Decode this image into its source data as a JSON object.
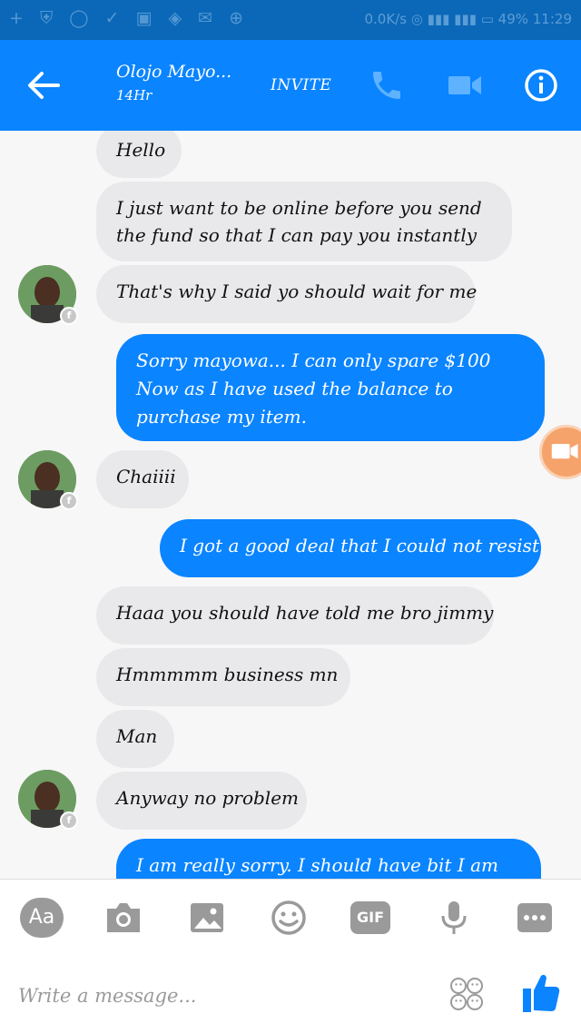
{
  "status_bar": {
    "left_icons": "+ ⛨ ◯ ✓ ▣ ◈ ✉ ⊕",
    "right_text": "0.0K/s  ◎  ▮▮▮  ▮▮▮  ▭ 49%  11:29"
  },
  "header": {
    "back_icon": "arrow-left-icon",
    "name": "Olojo Mayo...",
    "subtitle": "14Hr",
    "invite_label": "INVITE",
    "call_icon": "phone-icon",
    "video_icon": "video-camera-icon",
    "info_icon": "info-icon",
    "color": "#0a84ff"
  },
  "messages": [
    {
      "from": "them",
      "text": "Hello"
    },
    {
      "from": "them",
      "text": "I just want to be online before you send the fund so that I can pay you instantly"
    },
    {
      "from": "them",
      "text": "That's why I said yo should wait for me"
    },
    {
      "from": "me",
      "text": "Sorry mayowa... I can only spare $100 Now as I have used the balance to purchase my item."
    },
    {
      "from": "them",
      "text": "Chaiiii"
    },
    {
      "from": "me",
      "text": "I got a good deal that I could not resist."
    },
    {
      "from": "them",
      "text": "Haaa you should have told me bro jimmy"
    },
    {
      "from": "them",
      "text": "Hmmmmm business mn"
    },
    {
      "from": "them",
      "text": "Man"
    },
    {
      "from": "them",
      "text": "Anyway no problem"
    },
    {
      "from": "me",
      "text": "I am really sorry. I should have bit I am"
    }
  ],
  "composer": {
    "aa_label": "Aa",
    "gif_label": "GIF",
    "placeholder": "Write a message...",
    "icons": [
      "text-format-icon",
      "camera-icon",
      "image-icon",
      "smiley-icon",
      "gif-icon",
      "microphone-icon",
      "more-icon",
      "emoji-picker-icon",
      "thumbs-up-icon"
    ]
  }
}
